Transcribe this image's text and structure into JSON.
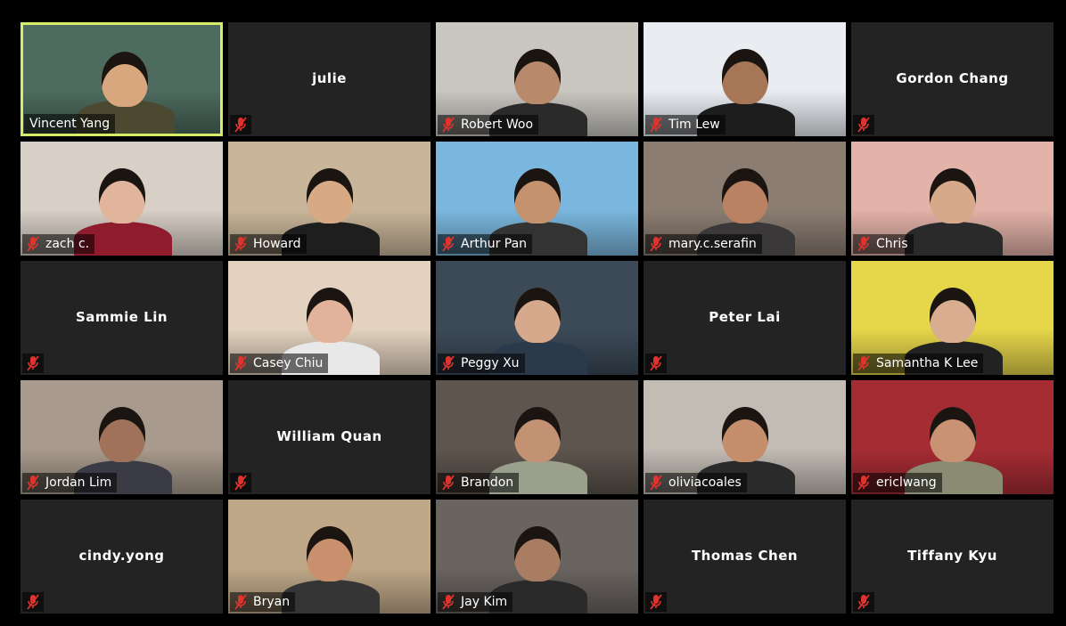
{
  "participants": [
    {
      "name": "Vincent Yang",
      "video": true,
      "muted": false,
      "active": true,
      "bg": "#4d6b5e",
      "skin": "#d9a77e",
      "shirt": "#4b4a30"
    },
    {
      "name": "julie",
      "video": false,
      "muted": true
    },
    {
      "name": "Robert Woo",
      "video": true,
      "muted": true,
      "bg": "#c9c6c0",
      "skin": "#b8896b",
      "shirt": "#2a2a2a"
    },
    {
      "name": "Tim Lew",
      "video": true,
      "muted": true,
      "bg": "#e9edf2",
      "skin": "#a77656",
      "shirt": "#1d1d1d"
    },
    {
      "name": "Gordon Chang",
      "video": false,
      "muted": true
    },
    {
      "name": "zach c.",
      "video": true,
      "muted": true,
      "bg": "#d8cfc6",
      "skin": "#e1b59b",
      "shirt": "#8e1c2c"
    },
    {
      "name": "Howard",
      "video": true,
      "muted": true,
      "bg": "#c9b69a",
      "skin": "#d7a985",
      "shirt": "#1e1e1e"
    },
    {
      "name": "Arthur Pan",
      "video": true,
      "muted": true,
      "bg": "#7ab7de",
      "skin": "#c4926f",
      "shirt": "#333333"
    },
    {
      "name": "mary.c.serafin",
      "video": true,
      "muted": true,
      "bg": "#8b7d72",
      "skin": "#b98263",
      "shirt": "#3a3838"
    },
    {
      "name": "Chris",
      "video": true,
      "muted": true,
      "bg": "#e3b2a8",
      "skin": "#d7a98b",
      "shirt": "#2a2a2a"
    },
    {
      "name": "Sammie Lin",
      "video": false,
      "muted": true
    },
    {
      "name": "Casey Chiu",
      "video": true,
      "muted": true,
      "bg": "#e2d2bf",
      "skin": "#e1b39a",
      "shirt": "#e8e8e8"
    },
    {
      "name": "Peggy Xu",
      "video": true,
      "muted": true,
      "bg": "#3c4a58",
      "skin": "#d6a88c",
      "shirt": "#2a3a4a"
    },
    {
      "name": "Peter Lai",
      "video": false,
      "muted": true
    },
    {
      "name": "Samantha K Lee",
      "video": true,
      "muted": true,
      "bg": "#e6d64a",
      "skin": "#d9ad8f",
      "shirt": "#222222"
    },
    {
      "name": "Jordan Lim",
      "video": true,
      "muted": true,
      "bg": "#a89a8c",
      "skin": "#9f7259",
      "shirt": "#3b3b46"
    },
    {
      "name": "William Quan",
      "video": false,
      "muted": true
    },
    {
      "name": "Brandon",
      "video": true,
      "muted": true,
      "bg": "#5e554e",
      "skin": "#c39273",
      "shirt": "#9aa08c"
    },
    {
      "name": "oliviacoales",
      "video": true,
      "muted": true,
      "bg": "#c3bcb5",
      "skin": "#c48e6d",
      "shirt": "#2a2a2a"
    },
    {
      "name": "ericlwang",
      "video": true,
      "muted": true,
      "bg": "#a62c34",
      "skin": "#c89273",
      "shirt": "#8b8a72"
    },
    {
      "name": "cindy.yong",
      "video": false,
      "muted": true
    },
    {
      "name": "Bryan",
      "video": true,
      "muted": true,
      "bg": "#bfa888",
      "skin": "#c8906c",
      "shirt": "#353535"
    },
    {
      "name": "Jay Kim",
      "video": true,
      "muted": true,
      "bg": "#6a6460",
      "skin": "#a87d62",
      "shirt": "#2a2a2a"
    },
    {
      "name": "Thomas Chen",
      "video": false,
      "muted": true
    },
    {
      "name": "Tiffany Kyu",
      "video": false,
      "muted": true
    }
  ],
  "icons": {
    "muted": "mic-muted-icon"
  },
  "colors": {
    "active_border": "#d7ed6a",
    "tile_bg": "#232323",
    "mute_red": "#e0332d"
  }
}
